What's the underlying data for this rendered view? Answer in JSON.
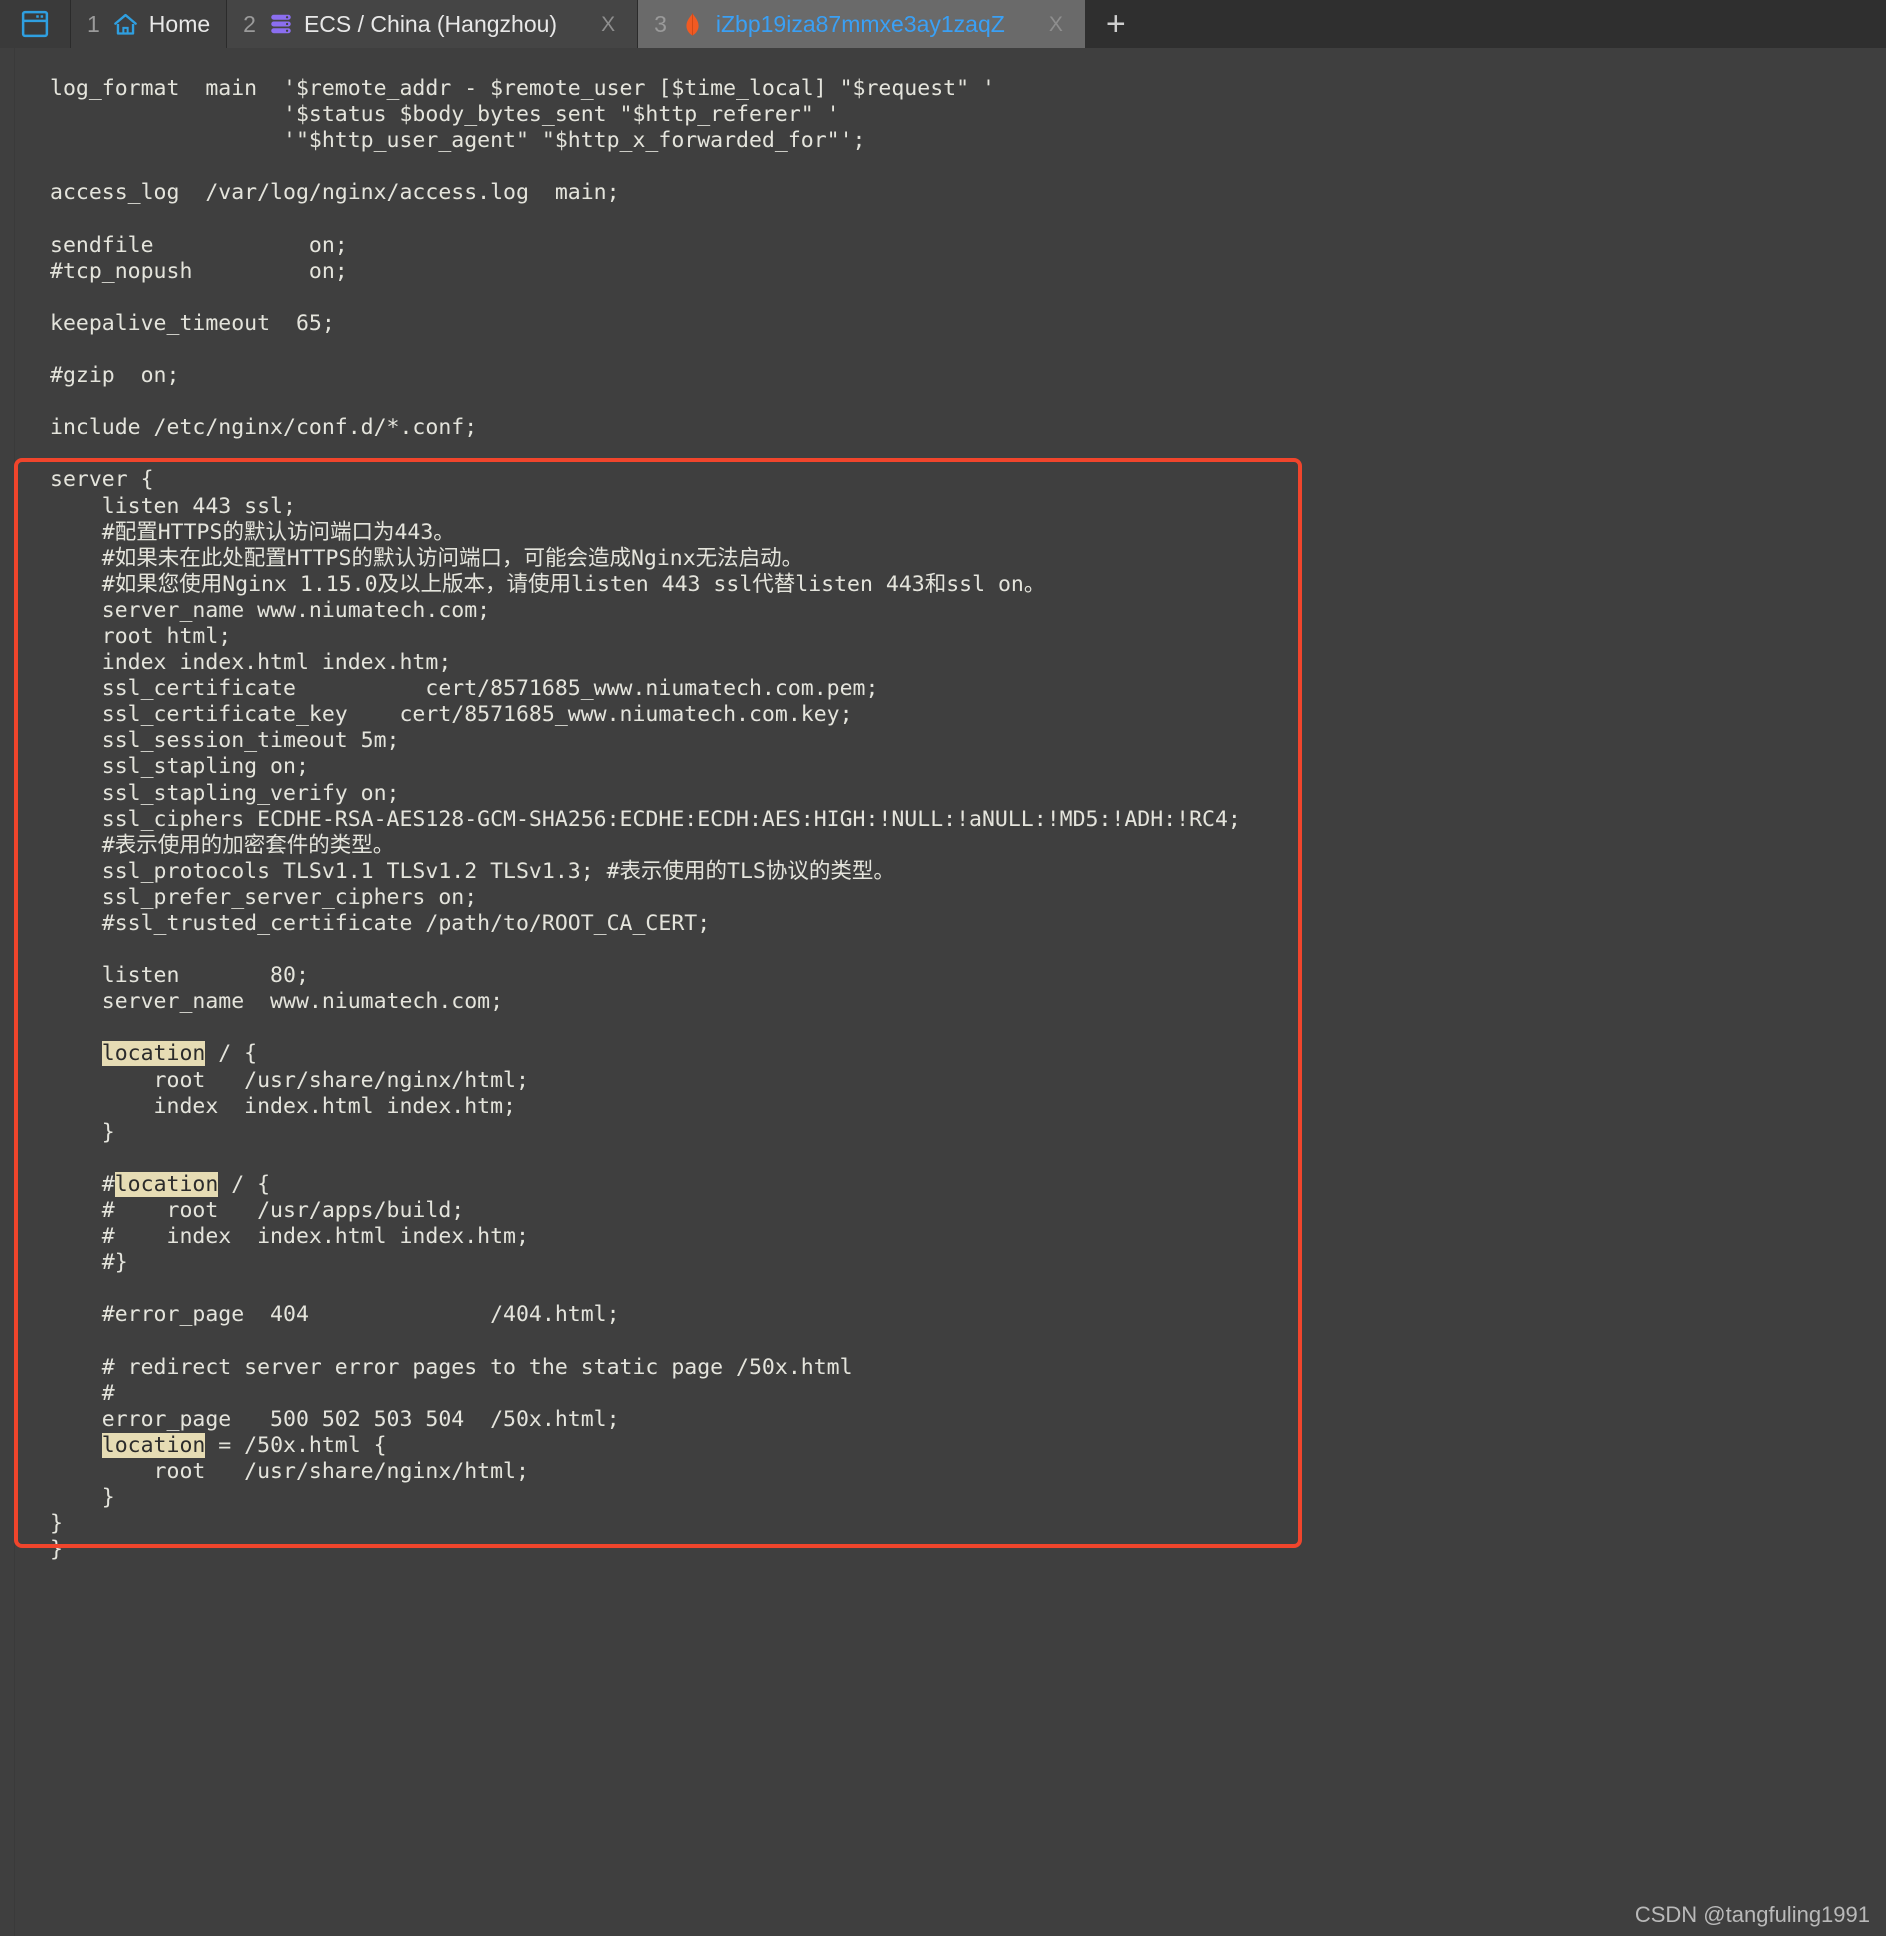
{
  "window": {
    "logo_icon": "terminal-app-icon"
  },
  "tabs": [
    {
      "index": "1",
      "label": "Home",
      "icon": "home-icon",
      "active": false,
      "closable": false
    },
    {
      "index": "2",
      "label": "ECS / China (Hangzhou)",
      "icon": "server-stack-icon",
      "active": false,
      "closable": true,
      "close_label": "X"
    },
    {
      "index": "3",
      "label": "iZbp19iza87mmxe3ay1zaqZ",
      "icon": "alibaba-cloud-icon",
      "active": true,
      "closable": true,
      "close_label": "X"
    }
  ],
  "new_tab_label": "+",
  "colors": {
    "accent_tab": "#3aa0f5",
    "highlight_box": "#f0452c",
    "search_highlight": "#e6dcb4",
    "terminal_bg": "#3f3f3f",
    "terminal_fg": "#e4e4dc"
  },
  "editor": {
    "lines_before_box": [
      "log_format  main  '$remote_addr - $remote_user [$time_local] \"$request\" '",
      "                  '$status $body_bytes_sent \"$http_referer\" '",
      "                  '\"$http_user_agent\" \"$http_x_forwarded_for\"';",
      "",
      "access_log  /var/log/nginx/access.log  main;",
      "",
      "sendfile            on;",
      "#tcp_nopush         on;",
      "",
      "keepalive_timeout  65;",
      "",
      "#gzip  on;",
      "",
      "include /etc/nginx/conf.d/*.conf;"
    ],
    "lines_in_box": [
      "server {",
      "    listen 443 ssl;",
      "    #配置HTTPS的默认访问端口为443。",
      "    #如果未在此处配置HTTPS的默认访问端口，可能会造成Nginx无法启动。",
      "    #如果您使用Nginx 1.15.0及以上版本，请使用listen 443 ssl代替listen 443和ssl on。",
      "    server_name www.niumatech.com;",
      "    root html;",
      "    index index.html index.htm;",
      "    ssl_certificate          cert/8571685_www.niumatech.com.pem;",
      "    ssl_certificate_key    cert/8571685_www.niumatech.com.key;",
      "    ssl_session_timeout 5m;",
      "    ssl_stapling on;",
      "    ssl_stapling_verify on;",
      "    ssl_ciphers ECDHE-RSA-AES128-GCM-SHA256:ECDHE:ECDH:AES:HIGH:!NULL:!aNULL:!MD5:!ADH:!RC4;",
      "    #表示使用的加密套件的类型。",
      "    ssl_protocols TLSv1.1 TLSv1.2 TLSv1.3; #表示使用的TLS协议的类型。",
      "    ssl_prefer_server_ciphers on;",
      "    #ssl_trusted_certificate /path/to/ROOT_CA_CERT;",
      "",
      "    listen       80;",
      "    server_name  www.niumatech.com;",
      "",
      "    location / {",
      "        root   /usr/share/nginx/html;",
      "        index  index.html index.htm;",
      "    }",
      "",
      "    #location / {",
      "    #    root   /usr/apps/build;",
      "    #    index  index.html index.htm;",
      "    #}",
      "",
      "    #error_page  404              /404.html;",
      "",
      "    # redirect server error pages to the static page /50x.html",
      "    #",
      "    error_page   500 502 503 504  /50x.html;",
      "    location = /50x.html {",
      "        root   /usr/share/nginx/html;",
      "    }",
      "}"
    ],
    "lines_after_box": [
      "}"
    ],
    "search_term": "location",
    "search_match_count": 3
  },
  "watermark": "CSDN @tangfuling1991"
}
